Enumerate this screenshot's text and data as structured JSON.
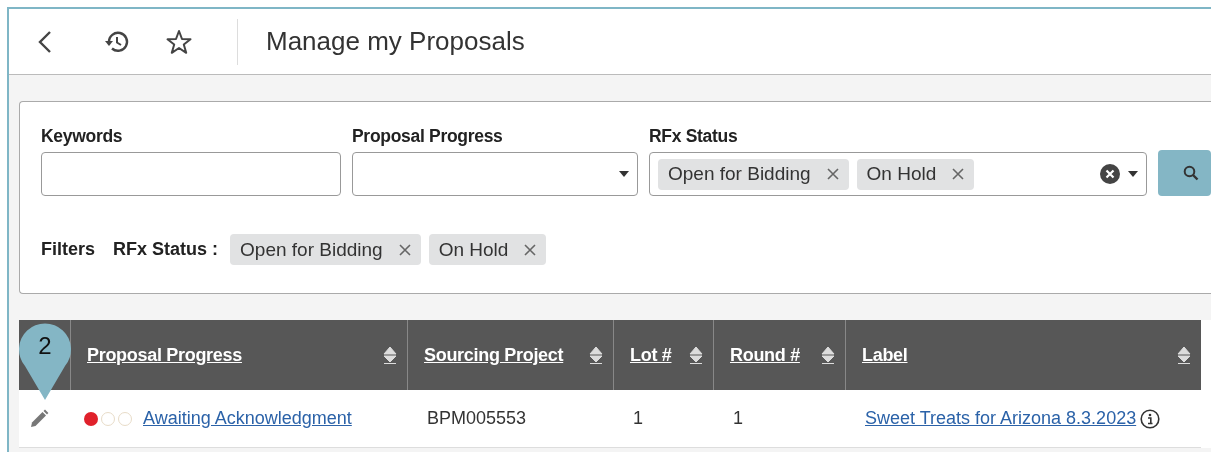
{
  "header": {
    "title": "Manage my Proposals"
  },
  "filters": {
    "fields": [
      {
        "kind": "text",
        "label": "Keywords"
      },
      {
        "kind": "select",
        "label": "Proposal Progress"
      },
      {
        "kind": "multiselect",
        "label": "RFx Status",
        "tags": [
          "Open for Bidding",
          "On Hold"
        ]
      }
    ],
    "applied_label": "Filters",
    "applied": [
      {
        "name": "RFx Status :",
        "tags": [
          "Open for Bidding",
          "On Hold"
        ]
      }
    ]
  },
  "table": {
    "columns": [
      {
        "label": "Proposal Progress"
      },
      {
        "label": "Sourcing Project"
      },
      {
        "label": "Lot #"
      },
      {
        "label": "Round #"
      },
      {
        "label": "Label"
      }
    ],
    "rows": [
      {
        "progress_steps": [
          {
            "done": true
          },
          {
            "done": false
          },
          {
            "done": false
          }
        ],
        "progress": "Awaiting Acknowledgment",
        "project": "BPM005553",
        "lot": "1",
        "round": "1",
        "label": "Sweet Treats for Arizona 8.3.2023"
      }
    ]
  },
  "callout": {
    "number": "2"
  }
}
